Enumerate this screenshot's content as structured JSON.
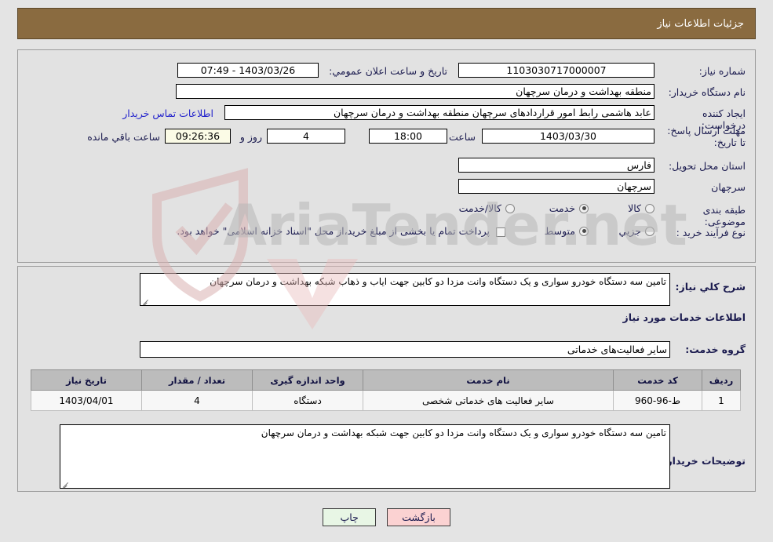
{
  "header": {
    "title": "جزئیات اطلاعات نیاز"
  },
  "form": {
    "need_number_label": "شماره نیاز:",
    "need_number_value": "1103030717000007",
    "announce_label": "تاریخ و ساعت اعلان عمومي:",
    "announce_value": "1403/03/26 - 07:49",
    "buyer_org_label": "نام دستگاه خریدار:",
    "buyer_org_value": "منطقه بهداشت و درمان سرچهان",
    "requester_label": "ایجاد کننده درخواست:",
    "requester_value": "عابد هاشمی رابط امور قراردادهای سرچهان منطقه بهداشت و درمان سرچهان",
    "buyer_contact_link": "اطلاعات تماس خریدار",
    "deadline_label": "مهلت ارسال پاسخ: تا تاریخ:",
    "deadline_date": "1403/03/30",
    "hour_label": "ساعت",
    "deadline_time": "18:00",
    "days_value": "4",
    "days_label": "روز و",
    "remaining_time": "09:26:36",
    "remaining_label": "ساعت باقي مانده",
    "province_label": "استان محل تحویل:",
    "province_value": "فارس",
    "city_label": "شهر محل تحویل:",
    "city_value": "سرچهان",
    "category_label": "طبقه بندی موضوعی:",
    "category_options": [
      {
        "label": "کالا",
        "selected": false
      },
      {
        "label": "خدمت",
        "selected": true
      },
      {
        "label": "کالا/خدمت",
        "selected": false
      }
    ],
    "process_label": "نوع فرآیند خرید :",
    "process_options": [
      {
        "label": "جزیي",
        "selected": false
      },
      {
        "label": "متوسط",
        "selected": true
      }
    ],
    "treasury_checkbox_checked": false,
    "treasury_note": "پرداخت تمام یا بخشی از مبلغ خرید،از محل \"اسناد خزانه اسلامی\" خواهد بود."
  },
  "description": {
    "general_label": "شرح کلي نیاز:",
    "general_value": "تامین سه دستگاه خودرو سواری و یک دستگاه وانت مزدا  دو کابین جهت ایاب و ذهاب شبکه بهداشت و درمان سرچهان",
    "services_heading": "اطلاعات خدمات مورد نیاز",
    "service_group_label": "گروه خدمت:",
    "service_group_value": "سایر فعالیت‌های خدماتی",
    "buyer_notes_label": "توضیحات خریدار:",
    "buyer_notes_value": "تامین سه دستگاه خودرو سواری و یک دستگاه وانت مزدا دو کابین جهت شبکه بهداشت و درمان سرچهان"
  },
  "table": {
    "columns": [
      "ردیف",
      "کد خدمت",
      "نام خدمت",
      "واحد اندازه گیری",
      "تعداد / مقدار",
      "تاریخ نیاز"
    ],
    "rows": [
      {
        "index": "1",
        "code": "ط-96-960",
        "name": "سایر فعالیت های خدماتی شخصی",
        "unit": "دستگاه",
        "quantity": "4",
        "date": "1403/04/01"
      }
    ]
  },
  "buttons": {
    "print": "چاپ",
    "back": "بازگشت"
  },
  "watermark": {
    "text": "AriaTender.net"
  },
  "colors": {
    "titlebar": "#8a6b40",
    "page_bg": "#e4e4e4",
    "panel_bg": "#e2e2e2",
    "label_text": "#1b1b4f",
    "link": "#2222cc",
    "header_row": "#bcbcbc",
    "print_btn": "#e8f6e5",
    "back_btn": "#fbd2d2",
    "highlight_field": "#fbfbe6"
  }
}
